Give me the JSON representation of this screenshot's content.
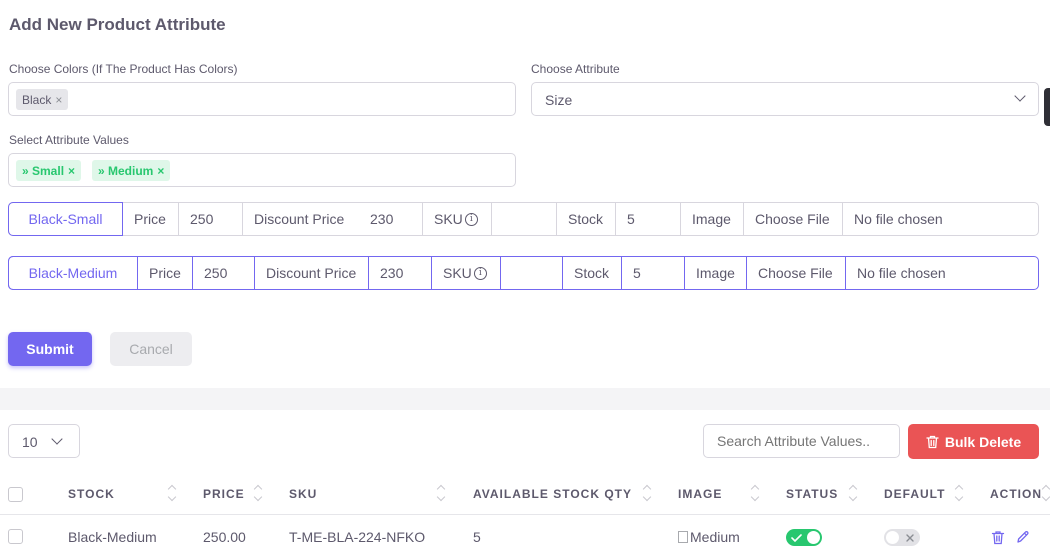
{
  "form": {
    "title": "Add New Product Attribute",
    "colors_label": "Choose Colors (If The Product Has Colors)",
    "colors_tags": [
      {
        "label": "Black"
      }
    ],
    "attribute_label": "Choose Attribute",
    "attribute_value": "Size",
    "values_label": "Select Attribute Values",
    "values_tags": [
      {
        "label": "» Small"
      },
      {
        "label": "» Medium"
      }
    ],
    "remove_glyph": "×",
    "variants": [
      {
        "name": "Black-Small",
        "price_label": "Price",
        "price": "250",
        "discount_label": "Discount Price",
        "discount": "230",
        "sku_label": "SKU",
        "sku": "",
        "stock_label": "Stock",
        "stock": "5",
        "image_label": "Image",
        "file_button": "Choose File",
        "file_status": "No file chosen"
      },
      {
        "name": "Black-Medium",
        "price_label": "Price",
        "price": "250",
        "discount_label": "Discount Price",
        "discount": "230",
        "sku_label": "SKU",
        "sku": "",
        "stock_label": "Stock",
        "stock": "5",
        "image_label": "Image",
        "file_button": "Choose File",
        "file_status": "No file chosen"
      }
    ],
    "submit_label": "Submit",
    "cancel_label": "Cancel"
  },
  "table": {
    "page_size": "10",
    "search_placeholder": "Search Attribute Values..",
    "bulk_delete_label": "Bulk Delete",
    "columns": [
      "STOCK",
      "PRICE",
      "SKU",
      "AVAILABLE STOCK QTY",
      "IMAGE",
      "STATUS",
      "DEFAULT",
      "ACTION"
    ],
    "rows": [
      {
        "stock": "Black-Medium",
        "price": "250.00",
        "sku": "T-ME-BLA-224-NFKO",
        "qty": "5",
        "image_alt": "Medium",
        "status": true,
        "default": false
      }
    ]
  },
  "colors": {
    "primary": "#7367f0",
    "success": "#28c76f",
    "danger": "#ea5455"
  }
}
